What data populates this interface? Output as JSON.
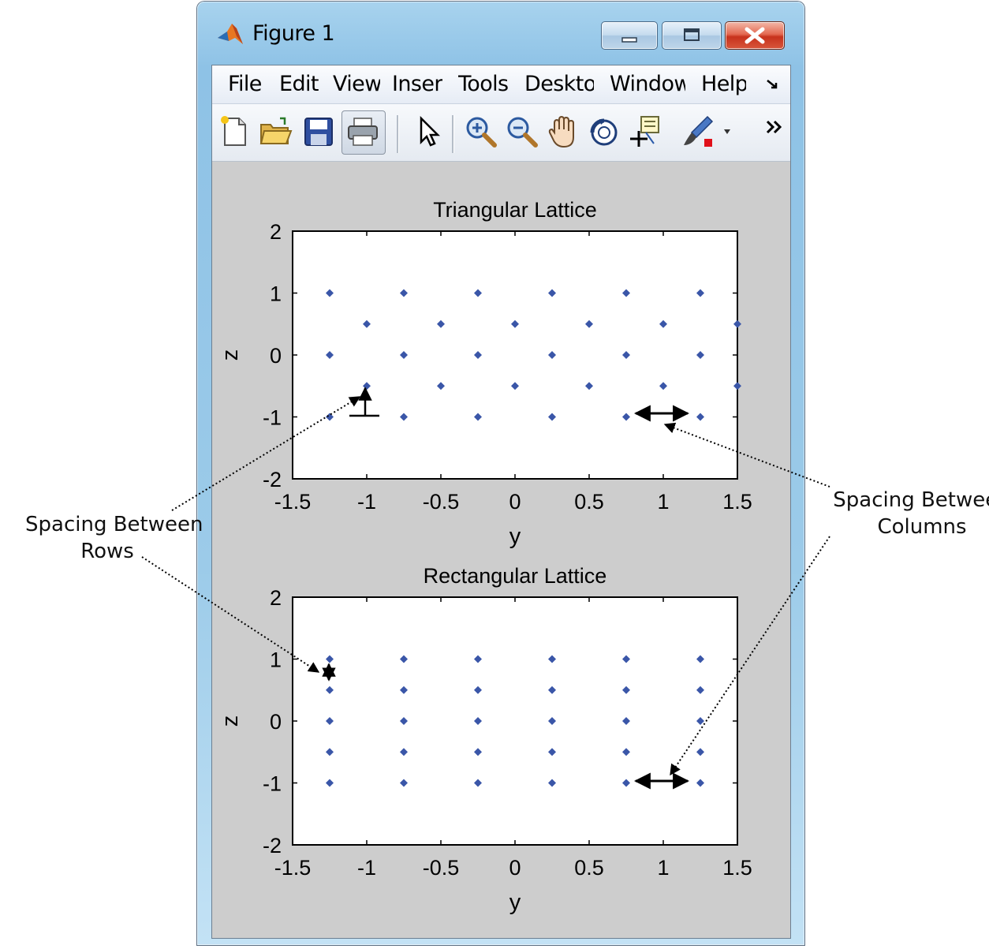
{
  "window": {
    "title": "Figure 1",
    "icon": "matlab-logo-icon",
    "controls": [
      "minimize-icon",
      "maximize-icon",
      "close-icon"
    ]
  },
  "menu": {
    "items": [
      "File",
      "Edit",
      "View",
      "Insert",
      "Tools",
      "Desktop",
      "Window",
      "Help"
    ],
    "overflow_icon": "menu-overflow-arrow-icon"
  },
  "toolbar": {
    "buttons": [
      "new-figure-icon",
      "open-file-icon",
      "save-icon",
      "print-icon",
      "pointer-icon",
      "zoom-in-icon",
      "zoom-out-icon",
      "pan-hand-icon",
      "rotate-3d-icon",
      "data-cursor-icon",
      "brush-icon",
      "dropdown-arrow-icon",
      "toolbar-overflow-icon"
    ]
  },
  "colors": {
    "marker": "#3a56a8",
    "axes_bg": "#ffffff",
    "figure_bg": "#cdcdcd"
  },
  "chart_data": [
    {
      "type": "scatter",
      "title": "Triangular Lattice",
      "xlabel": "y",
      "ylabel": "z",
      "xlim": [
        -1.5,
        1.5
      ],
      "ylim": [
        -2,
        2
      ],
      "xticks": [
        "-1.5",
        "-1",
        "-0.5",
        "0",
        "0.5",
        "1",
        "1.5"
      ],
      "yticks": [
        "-2",
        "-1",
        "0",
        "1",
        "2"
      ],
      "series": [
        {
          "x": [
            -1.25,
            -0.75,
            -0.25,
            0.25,
            0.75,
            1.25,
            -1,
            -0.5,
            0,
            0.5,
            1,
            1.5,
            -1.25,
            -0.75,
            -0.25,
            0.25,
            0.75,
            1.25,
            -1,
            -0.5,
            0,
            0.5,
            1,
            1.5,
            -1.25,
            -0.75,
            -0.25,
            0.25,
            0.75,
            1.25
          ],
          "y": [
            1,
            1,
            1,
            1,
            1,
            1,
            0.5,
            0.5,
            0.5,
            0.5,
            0.5,
            0.5,
            0,
            0,
            0,
            0,
            0,
            0,
            -0.5,
            -0.5,
            -0.5,
            -0.5,
            -0.5,
            -0.5,
            -1,
            -1,
            -1,
            -1,
            -1,
            -1
          ]
        }
      ]
    },
    {
      "type": "scatter",
      "title": "Rectangular Lattice",
      "xlabel": "y",
      "ylabel": "z",
      "xlim": [
        -1.5,
        1.5
      ],
      "ylim": [
        -2,
        2
      ],
      "xticks": [
        "-1.5",
        "-1",
        "-0.5",
        "0",
        "0.5",
        "1",
        "1.5"
      ],
      "yticks": [
        "-2",
        "-1",
        "0",
        "1",
        "2"
      ],
      "series": [
        {
          "x": [
            -1.25,
            -0.75,
            -0.25,
            0.25,
            0.75,
            1.25,
            -1.25,
            -0.75,
            -0.25,
            0.25,
            0.75,
            1.25,
            -1.25,
            -0.75,
            -0.25,
            0.25,
            0.75,
            1.25,
            -1.25,
            -0.75,
            -0.25,
            0.25,
            0.75,
            1.25,
            -1.25,
            -0.75,
            -0.25,
            0.25,
            0.75,
            1.25
          ],
          "y": [
            1,
            1,
            1,
            1,
            1,
            1,
            0.5,
            0.5,
            0.5,
            0.5,
            0.5,
            0.5,
            0,
            0,
            0,
            0,
            0,
            0,
            -0.5,
            -0.5,
            -0.5,
            -0.5,
            -0.5,
            -0.5,
            -1,
            -1,
            -1,
            -1,
            -1,
            -1
          ]
        }
      ]
    }
  ],
  "annotations": {
    "rows_label": "Spacing Between\nRows",
    "columns_label": "Spacing Between\nColumns"
  }
}
